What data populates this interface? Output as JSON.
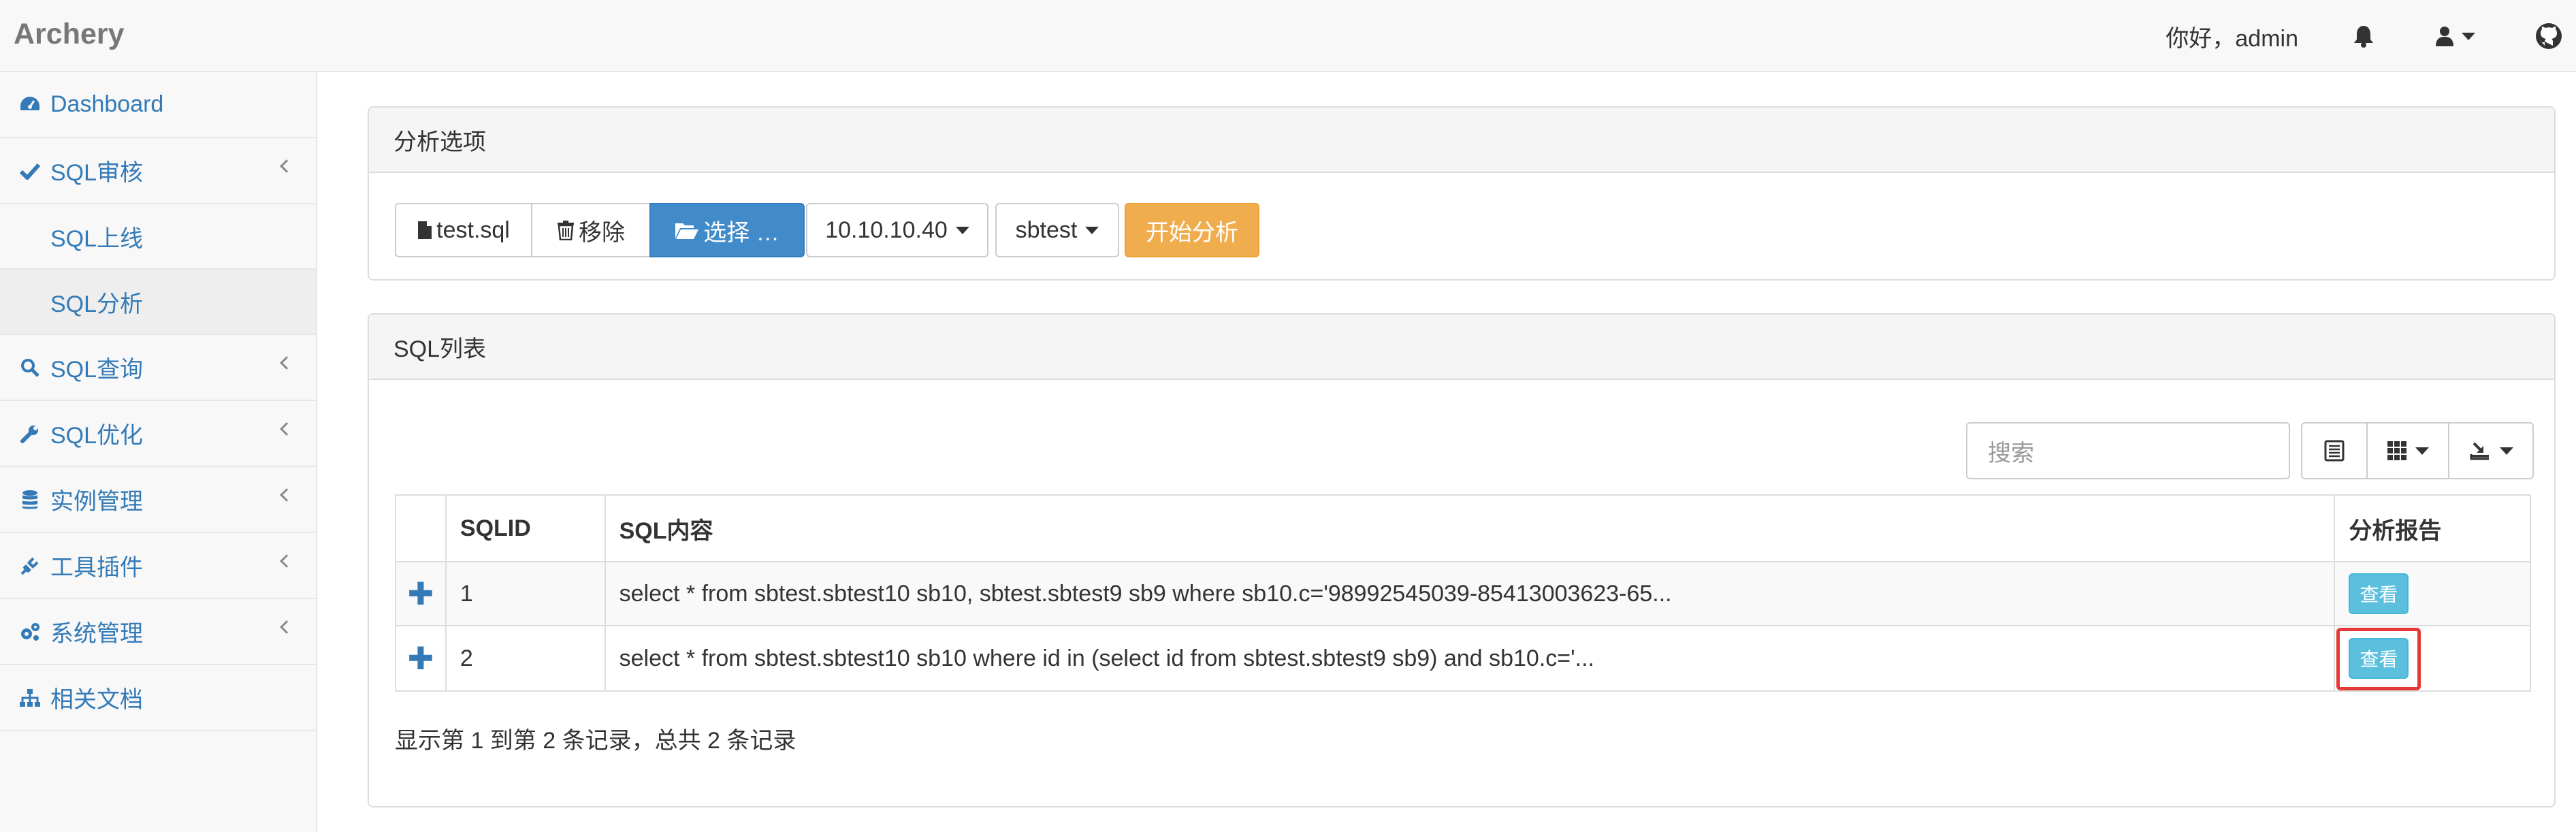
{
  "app": {
    "brand": "Archery"
  },
  "header": {
    "greeting": "你好，admin"
  },
  "sidebar": {
    "items": [
      {
        "label": "Dashboard",
        "icon": "dashboard-icon"
      },
      {
        "label": "SQL审核",
        "icon": "check-icon",
        "expandable": true
      },
      {
        "label": "SQL上线",
        "sub": true
      },
      {
        "label": "SQL分析",
        "sub": true,
        "active": true
      },
      {
        "label": "SQL查询",
        "icon": "search-icon",
        "expandable": true
      },
      {
        "label": "SQL优化",
        "icon": "wrench-icon",
        "expandable": true
      },
      {
        "label": "实例管理",
        "icon": "database-icon",
        "expandable": true
      },
      {
        "label": "工具插件",
        "icon": "plug-icon",
        "expandable": true
      },
      {
        "label": "系统管理",
        "icon": "cogs-icon",
        "expandable": true
      },
      {
        "label": "相关文档",
        "icon": "sitemap-icon"
      }
    ]
  },
  "analysis_panel": {
    "title": "分析选项",
    "file_name": "test.sql",
    "remove_label": "移除",
    "choose_label": "选择 …",
    "instance": "10.10.10.40",
    "database": "sbtest",
    "start_label": "开始分析"
  },
  "sql_panel": {
    "title": "SQL列表",
    "search_placeholder": "搜索",
    "columns": [
      "SQLID",
      "SQL内容",
      "分析报告"
    ],
    "rows": [
      {
        "id": "1",
        "content": "select * from sbtest.sbtest10 sb10, sbtest.sbtest9 sb9 where sb10.c='98992545039-85413003623-65...",
        "action": "查看"
      },
      {
        "id": "2",
        "content": "select * from sbtest.sbtest10 sb10 where id in (select id from sbtest.sbtest9 sb9) and sb10.c='...",
        "action": "查看"
      }
    ],
    "footer": "显示第 1 到第 2 条记录，总共 2 条记录"
  },
  "colors": {
    "link": "#337ab7",
    "primary": "#428bca",
    "warning": "#f0ad4e",
    "info": "#5bc0de",
    "highlight": "#e53935"
  }
}
